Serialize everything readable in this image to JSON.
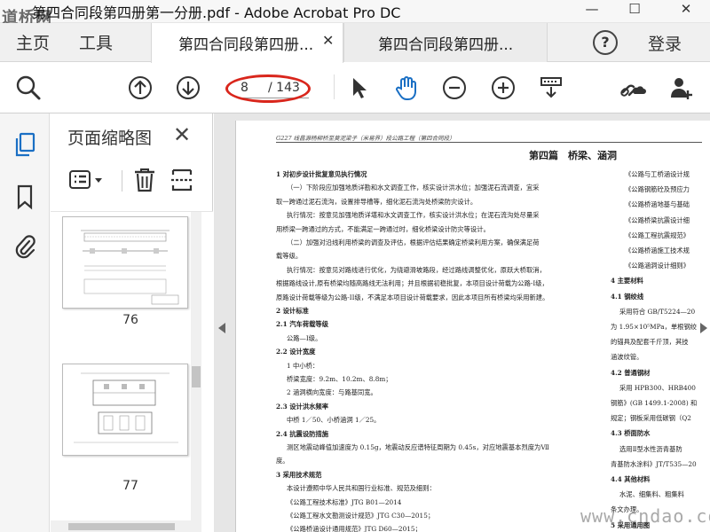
{
  "window": {
    "title": "第四合同段第四册第一分册.pdf - Adobe Acrobat Pro DC",
    "watermark_topleft": "道桥网",
    "minimize": "—",
    "maximize": "☐",
    "close": "✕"
  },
  "tabs": {
    "home": "主页",
    "tools": "工具",
    "doc_tabs": [
      {
        "label": "第四合同段第四册..."
      },
      {
        "label": "第四合同段第四册..."
      }
    ],
    "close_symbol": "✕",
    "help": "?",
    "login": "登录"
  },
  "toolbar": {
    "current_page": "8",
    "total_pages": "/ 143",
    "highlight_color": "#d9261c",
    "accent": "#1a6fc4"
  },
  "panel": {
    "title": "页面缩略图",
    "close": "✕",
    "thumbnails": [
      {
        "label": "76"
      },
      {
        "label": "77"
      }
    ]
  },
  "document": {
    "header": "G227 线昌源杨柳桥至莫泥梁子（米易界）段公路工程（第四合同段）",
    "part_title": "第四篇　桥梁、涵洞",
    "left_column": [
      {
        "text": "1  对初步设计批复意见执行情况",
        "bold": true
      },
      {
        "text": "（一）下阶段应加强地质详勘和水文调查工作，核实设计洪水位；加强泥石流调查，宜采",
        "bold": false
      },
      {
        "text": "取一跨通过泥石流沟，设置排导槽等，细化泥石流沟处桥梁防灾设计。",
        "bold": false
      },
      {
        "text": "执行情况：按意见加强地质详堪和水文调查工作，核实设计洪水位；在泥石流沟处尽量采",
        "bold": false
      },
      {
        "text": "用桥梁一跨通过的方式，不能满足一跨通过时，细化桥梁设计防灾等设计。",
        "bold": false
      },
      {
        "text": "（二）加强对沿线利用桥梁的调查及评估，根据评估结果确定桥梁利用方案，确保满足荷",
        "bold": false
      },
      {
        "text": "载等级。",
        "bold": false
      },
      {
        "text": "执行情况：按意见对路线进行优化，为绕避滑坡路段，经过路线调整优化，原跃大桥取消，",
        "bold": false
      },
      {
        "text": "根据路线设计,原有桥梁均随高路线无法利用；并且根据初稳批复，本项目设计荷载为公路-I级，",
        "bold": false
      },
      {
        "text": "原路设计荷载等级为公路-II级，不满足本项目设计荷载要求，因此本项目所有桥梁均采用新建。",
        "bold": false
      },
      {
        "text": "2  设计标准",
        "bold": true
      },
      {
        "text": "2.1  汽车荷载等级",
        "bold": true
      },
      {
        "text": "公路—Ⅰ级。",
        "bold": false
      },
      {
        "text": "2.2  设计宽度",
        "bold": true
      },
      {
        "text": "1  中小桥：",
        "bold": false
      },
      {
        "text": "桥梁宽度：9.2m、10.2m、8.8m；",
        "bold": false
      },
      {
        "text": "2  涵洞横向宽度：与路基同宽。",
        "bold": false
      },
      {
        "text": "2.3  设计洪水频率",
        "bold": true
      },
      {
        "text": "中桥 1／50、小桥涵洞 1／25。",
        "bold": false
      },
      {
        "text": "2.4  抗震设防措施",
        "bold": true
      },
      {
        "text": "测区地震动峰值加速度为 0.15g，地震动反应谱特征周期为 0.45s，对应地震基本烈度为Ⅶ",
        "bold": false
      },
      {
        "text": "度。",
        "bold": false
      },
      {
        "text": "3  采用技术规范",
        "bold": true
      },
      {
        "text": "本设计遵照中华人民共和国行业标准、规范及细则：",
        "bold": false
      },
      {
        "text": "《公路工程技术标准》JTG B01—2014",
        "bold": false
      },
      {
        "text": "《公路工程水文勘测设计规范》JTG C30—2015；",
        "bold": false
      },
      {
        "text": "《公路桥涵设计通用规范》JTG D60—2015；",
        "bold": false
      }
    ],
    "right_column": [
      {
        "text": "《公路与工桥涵设计规",
        "bold": false
      },
      {
        "text": "《公路钢筋砼及预应力",
        "bold": false
      },
      {
        "text": "《公路桥涵地基与基础",
        "bold": false
      },
      {
        "text": "《公路桥梁抗震设计细",
        "bold": false
      },
      {
        "text": "《公路工程抗震规范》",
        "bold": false
      },
      {
        "text": "《公路桥涵施工技术规",
        "bold": false
      },
      {
        "text": "《公路涵洞设计细则》",
        "bold": false
      },
      {
        "text": "4  主要材料",
        "bold": true
      },
      {
        "text": "4.1  钢绞线",
        "bold": true
      },
      {
        "text": "采用符合 GB/T5224—20",
        "bold": false
      },
      {
        "text": "为 1.95×10⁵MPa，单根钢绞",
        "bold": false
      },
      {
        "text": "的锚具及配套千斤顶，其技",
        "bold": false
      },
      {
        "text": "涵波纹管。",
        "bold": false
      },
      {
        "text": "4.2  普通钢材",
        "bold": true
      },
      {
        "text": "采用 HPB300、HRB400",
        "bold": false
      },
      {
        "text": "钢筋》(GB 1499.1-2008) 和",
        "bold": false
      },
      {
        "text": "规定；钢板采用低碳钢（Q2",
        "bold": false
      },
      {
        "text": "4.3  桥面防水",
        "bold": true
      },
      {
        "text": "选用Ⅱ型水性沥青基防",
        "bold": false
      },
      {
        "text": "青基防水涂料》JT/T535—20",
        "bold": false
      },
      {
        "text": "4.4  其他材料",
        "bold": true
      },
      {
        "text": "水泥、细集料、粗集料",
        "bold": false
      },
      {
        "text": "条文办理。",
        "bold": false
      },
      {
        "text": "5  采用通用图",
        "bold": true
      },
      {
        "text": "预应力砼简支带翼小箱",
        "bold": false
      },
      {
        "text": "结构及各桥具体设计图。",
        "bold": false
      }
    ]
  },
  "footer_watermark": "www.cndao.com"
}
